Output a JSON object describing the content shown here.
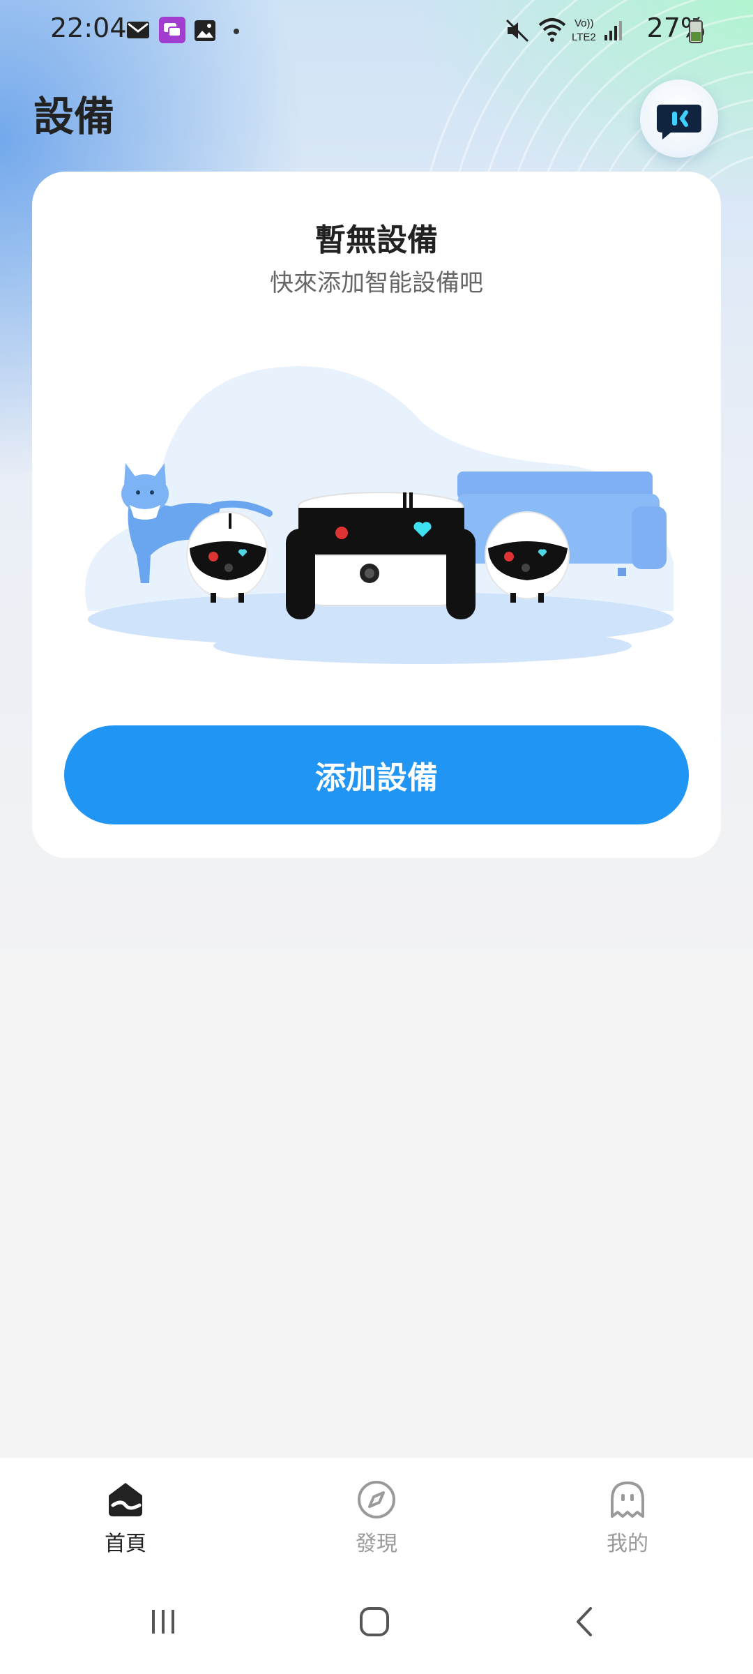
{
  "status_bar": {
    "time": "22:04",
    "battery": "27%",
    "icons": [
      "mail-icon",
      "messenger-icon",
      "gallery-icon",
      "dot-icon",
      "mute-icon",
      "wifi-icon",
      "volte-icon",
      "signal-icon",
      "battery-icon"
    ]
  },
  "header": {
    "title": "設備",
    "assistant_icon": "robot-chat-icon"
  },
  "card": {
    "title": "暫無設備",
    "subtitle": "快來添加智能設備吧",
    "button_label": "添加設備"
  },
  "bottom_nav": {
    "items": [
      {
        "label": "首頁",
        "icon": "home-icon",
        "active": true
      },
      {
        "label": "發現",
        "icon": "compass-icon",
        "active": false
      },
      {
        "label": "我的",
        "icon": "ghost-profile-icon",
        "active": false
      }
    ]
  },
  "colors": {
    "accent": "#2195f3",
    "active_nav": "#222222",
    "inactive_nav": "#9a9a9a"
  }
}
